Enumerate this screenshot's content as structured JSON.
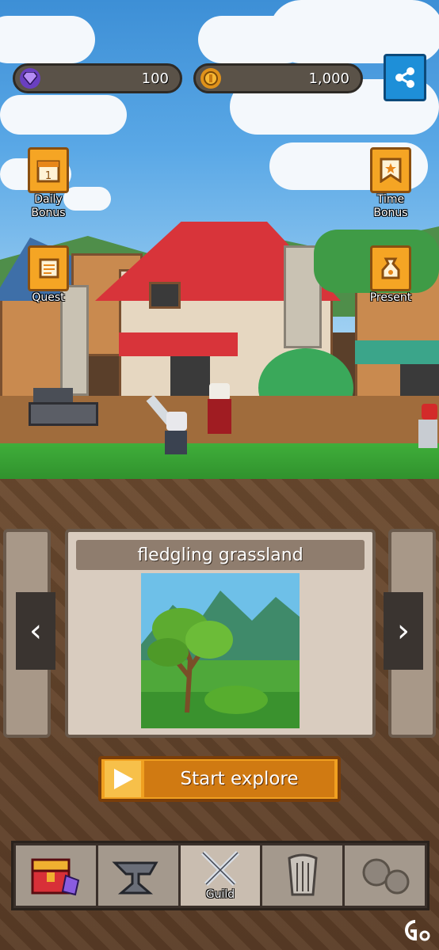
{
  "resources": {
    "gems": {
      "value": "100",
      "icon": "gem-icon",
      "color": "#6a3fc0"
    },
    "coins": {
      "value": "1,000",
      "icon": "coin-icon",
      "color": "#e0921a"
    }
  },
  "share": {
    "icon": "share-icon"
  },
  "side_buttons": {
    "daily_bonus": {
      "label": "Daily\nBonus",
      "icon": "calendar-icon"
    },
    "time_bonus": {
      "label": "Time\nBonus",
      "icon": "ribbon-icon"
    },
    "quest": {
      "label": "Quest",
      "icon": "scroll-icon"
    },
    "present": {
      "label": "Present",
      "icon": "bag-icon"
    }
  },
  "stage": {
    "title": "fledgling grassland",
    "prev_icon": "chevron-left-icon",
    "next_icon": "chevron-right-icon",
    "prev_glyph": "‹",
    "next_glyph": "›"
  },
  "start_button": {
    "label": "Start explore",
    "icon": "play-icon"
  },
  "bottom_nav": {
    "tabs": [
      {
        "id": "inventory",
        "icon": "treasure-chest-icon",
        "label": ""
      },
      {
        "id": "forge",
        "icon": "anvil-icon",
        "label": ""
      },
      {
        "id": "guild",
        "icon": "crossed-swords-icon",
        "label": "Guild",
        "active": true
      },
      {
        "id": "harp",
        "icon": "harp-icon",
        "label": ""
      },
      {
        "id": "locked",
        "icon": "rocks-icon",
        "label": ""
      }
    ]
  },
  "colors": {
    "accent": "#f0a020",
    "share_blue": "#1e8fd8"
  }
}
